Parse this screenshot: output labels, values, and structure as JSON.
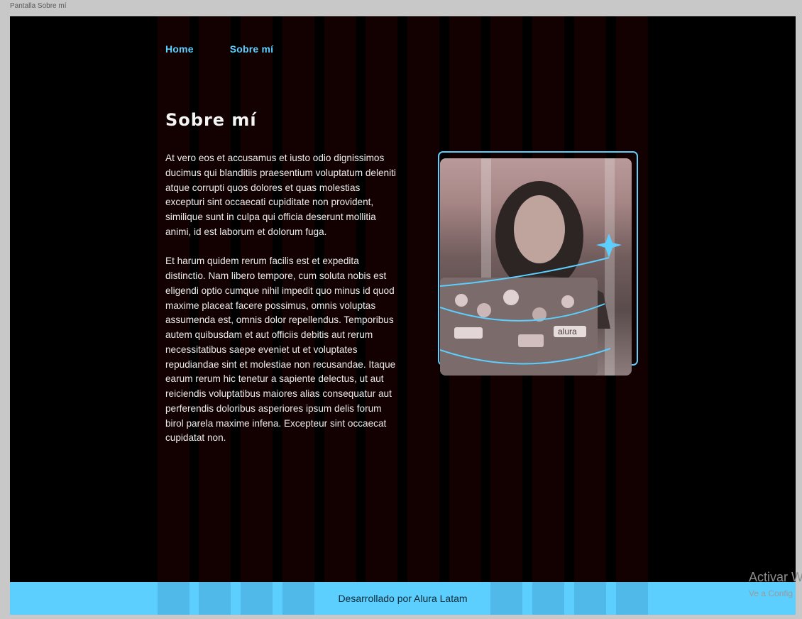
{
  "frame": {
    "label": "Pantalla Sobre mí"
  },
  "nav": {
    "home": "Home",
    "about": "Sobre mí"
  },
  "main": {
    "title": "Sobre mí",
    "paragraph1": "At vero eos et accusamus et iusto odio dignissimos ducimus qui blanditiis praesentium voluptatum deleniti atque corrupti quos dolores et quas molestias excepturi sint occaecati cupiditate non provident, similique sunt in culpa qui officia deserunt mollitia animi, id est laborum et dolorum fuga.",
    "paragraph2": "Et harum quidem rerum facilis est et expedita distinctio. Nam libero tempore, cum soluta nobis est eligendi optio cumque nihil impedit quo minus id quod maxime placeat facere possimus, omnis voluptas assumenda est, omnis dolor repellendus. Temporibus autem quibusdam et aut officiis debitis aut rerum necessitatibus saepe eveniet ut et voluptates repudiandae sint et molestiae non recusandae. Itaque earum rerum hic tenetur a sapiente delectus, ut aut reiciendis voluptatibus maiores alias consequatur aut perferendis doloribus asperiores ipsum delis forum birol parela maxime infena. Excepteur sint occaecat cupidatat non.",
    "photo_sticker_text": "alura"
  },
  "footer": {
    "text": "Desarrollado por Alura Latam"
  },
  "watermark": {
    "title": "Activar W",
    "subtitle": "Ve a Config"
  },
  "colors": {
    "accent": "#5ccfff",
    "background": "#000000",
    "text": "#ececec"
  }
}
